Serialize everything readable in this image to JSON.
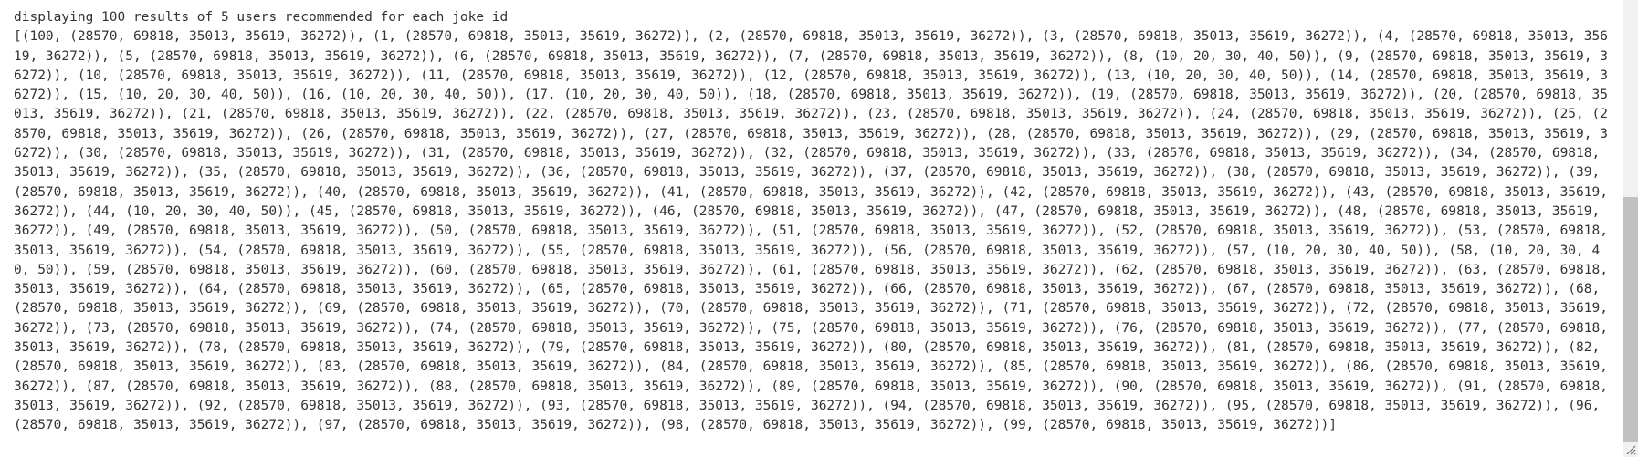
{
  "output": {
    "header": "displaying 100 results of 5 users recommended for each joke id",
    "result": "[(100, (28570, 69818, 35013, 35619, 36272)), (1, (28570, 69818, 35013, 35619, 36272)), (2, (28570, 69818, 35013, 35619, 36272)), (3, (28570, 69818, 35013, 35619, 36272)), (4, (28570, 69818, 35013, 35619, 36272)), (5, (28570, 69818, 35013, 35619, 36272)), (6, (28570, 69818, 35013, 35619, 36272)), (7, (28570, 69818, 35013, 35619, 36272)), (8, (10, 20, 30, 40, 50)), (9, (28570, 69818, 35013, 35619, 36272)), (10, (28570, 69818, 35013, 35619, 36272)), (11, (28570, 69818, 35013, 35619, 36272)), (12, (28570, 69818, 35013, 35619, 36272)), (13, (10, 20, 30, 40, 50)), (14, (28570, 69818, 35013, 35619, 36272)), (15, (10, 20, 30, 40, 50)), (16, (10, 20, 30, 40, 50)), (17, (10, 20, 30, 40, 50)), (18, (28570, 69818, 35013, 35619, 36272)), (19, (28570, 69818, 35013, 35619, 36272)), (20, (28570, 69818, 35013, 35619, 36272)), (21, (28570, 69818, 35013, 35619, 36272)), (22, (28570, 69818, 35013, 35619, 36272)), (23, (28570, 69818, 35013, 35619, 36272)), (24, (28570, 69818, 35013, 35619, 36272)), (25, (28570, 69818, 35013, 35619, 36272)), (26, (28570, 69818, 35013, 35619, 36272)), (27, (28570, 69818, 35013, 35619, 36272)), (28, (28570, 69818, 35013, 35619, 36272)), (29, (28570, 69818, 35013, 35619, 36272)), (30, (28570, 69818, 35013, 35619, 36272)), (31, (28570, 69818, 35013, 35619, 36272)), (32, (28570, 69818, 35013, 35619, 36272)), (33, (28570, 69818, 35013, 35619, 36272)), (34, (28570, 69818, 35013, 35619, 36272)), (35, (28570, 69818, 35013, 35619, 36272)), (36, (28570, 69818, 35013, 35619, 36272)), (37, (28570, 69818, 35013, 35619, 36272)), (38, (28570, 69818, 35013, 35619, 36272)), (39, (28570, 69818, 35013, 35619, 36272)), (40, (28570, 69818, 35013, 35619, 36272)), (41, (28570, 69818, 35013, 35619, 36272)), (42, (28570, 69818, 35013, 35619, 36272)), (43, (28570, 69818, 35013, 35619, 36272)), (44, (10, 20, 30, 40, 50)), (45, (28570, 69818, 35013, 35619, 36272)), (46, (28570, 69818, 35013, 35619, 36272)), (47, (28570, 69818, 35013, 35619, 36272)), (48, (28570, 69818, 35013, 35619, 36272)), (49, (28570, 69818, 35013, 35619, 36272)), (50, (28570, 69818, 35013, 35619, 36272)), (51, (28570, 69818, 35013, 35619, 36272)), (52, (28570, 69818, 35013, 35619, 36272)), (53, (28570, 69818, 35013, 35619, 36272)), (54, (28570, 69818, 35013, 35619, 36272)), (55, (28570, 69818, 35013, 35619, 36272)), (56, (28570, 69818, 35013, 35619, 36272)), (57, (10, 20, 30, 40, 50)), (58, (10, 20, 30, 40, 50)), (59, (28570, 69818, 35013, 35619, 36272)), (60, (28570, 69818, 35013, 35619, 36272)), (61, (28570, 69818, 35013, 35619, 36272)), (62, (28570, 69818, 35013, 35619, 36272)), (63, (28570, 69818, 35013, 35619, 36272)), (64, (28570, 69818, 35013, 35619, 36272)), (65, (28570, 69818, 35013, 35619, 36272)), (66, (28570, 69818, 35013, 35619, 36272)), (67, (28570, 69818, 35013, 35619, 36272)), (68, (28570, 69818, 35013, 35619, 36272)), (69, (28570, 69818, 35013, 35619, 36272)), (70, (28570, 69818, 35013, 35619, 36272)), (71, (28570, 69818, 35013, 35619, 36272)), (72, (28570, 69818, 35013, 35619, 36272)), (73, (28570, 69818, 35013, 35619, 36272)), (74, (28570, 69818, 35013, 35619, 36272)), (75, (28570, 69818, 35013, 35619, 36272)), (76, (28570, 69818, 35013, 35619, 36272)), (77, (28570, 69818, 35013, 35619, 36272)), (78, (28570, 69818, 35013, 35619, 36272)), (79, (28570, 69818, 35013, 35619, 36272)), (80, (28570, 69818, 35013, 35619, 36272)), (81, (28570, 69818, 35013, 35619, 36272)), (82, (28570, 69818, 35013, 35619, 36272)), (83, (28570, 69818, 35013, 35619, 36272)), (84, (28570, 69818, 35013, 35619, 36272)), (85, (28570, 69818, 35013, 35619, 36272)), (86, (28570, 69818, 35013, 35619, 36272)), (87, (28570, 69818, 35013, 35619, 36272)), (88, (28570, 69818, 35013, 35619, 36272)), (89, (28570, 69818, 35013, 35619, 36272)), (90, (28570, 69818, 35013, 35619, 36272)), (91, (28570, 69818, 35013, 35619, 36272)), (92, (28570, 69818, 35013, 35619, 36272)), (93, (28570, 69818, 35013, 35619, 36272)), (94, (28570, 69818, 35013, 35619, 36272)), (95, (28570, 69818, 35013, 35619, 36272)), (96, (28570, 69818, 35013, 35619, 36272)), (97, (28570, 69818, 35013, 35619, 36272)), (98, (28570, 69818, 35013, 35619, 36272)), (99, (28570, 69818, 35013, 35619, 36272))]"
  },
  "icons": {
    "resize": "resize-grip-icon"
  },
  "colors": {
    "text": "#333333",
    "background": "#ffffff",
    "scrollbar_track": "#f1f1f1",
    "scrollbar_thumb": "#c1c1c1"
  }
}
